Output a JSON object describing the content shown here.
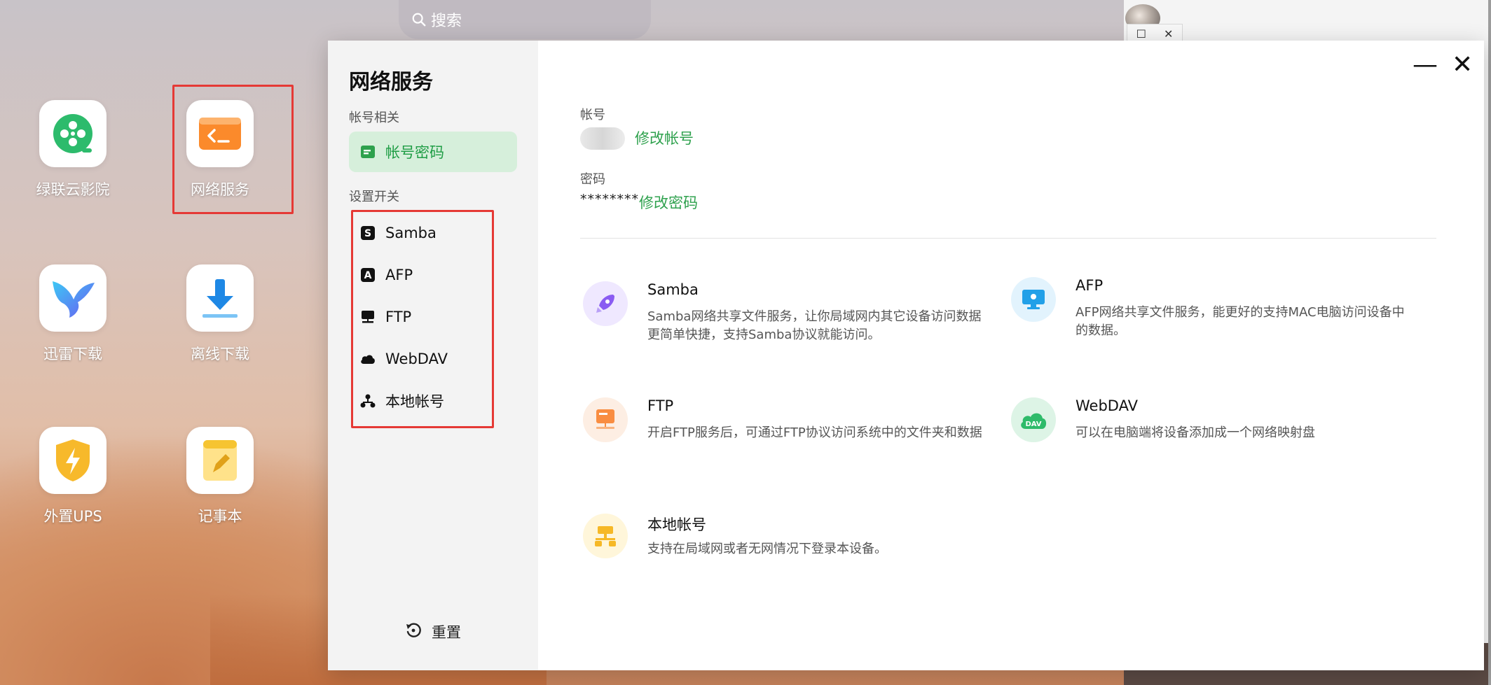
{
  "search": {
    "placeholder": "搜索"
  },
  "desktop": {
    "apps": [
      {
        "label": "绿联云影院",
        "icon": "film-reel-icon"
      },
      {
        "label": "网络服务",
        "icon": "terminal-icon"
      },
      {
        "label": "迅雷下载",
        "icon": "hummingbird-icon"
      },
      {
        "label": "离线下载",
        "icon": "download-arrow-icon"
      },
      {
        "label": "外置UPS",
        "icon": "shield-bolt-icon"
      },
      {
        "label": "记事本",
        "icon": "notepad-icon"
      }
    ]
  },
  "window": {
    "title": "网络服务",
    "sidebar": {
      "group_account": "帐号相关",
      "active_item": "帐号密码",
      "group_settings": "设置开关",
      "items": [
        "Samba",
        "AFP",
        "FTP",
        "WebDAV",
        "本地帐号"
      ],
      "reset_label": "重置"
    },
    "account": {
      "account_label": "帐号",
      "modify_account": "修改帐号",
      "password_label": "密码",
      "password_mask": "********",
      "modify_password": "修改密码"
    },
    "services": [
      {
        "name": "Samba",
        "desc": "Samba网络共享文件服务，让你局域网内其它设备访问数据更简单快捷，支持Samba协议就能访问。",
        "icon": "rocket-icon"
      },
      {
        "name": "AFP",
        "desc": "AFP网络共享文件服务，能更好的支持MAC电脑访问设备中的数据。",
        "icon": "mac-monitor-icon"
      },
      {
        "name": "FTP",
        "desc": "开启FTP服务后，可通过FTP协议访问系统中的文件夹和数据",
        "icon": "ftp-server-icon"
      },
      {
        "name": "WebDAV",
        "desc": "可以在电脑端将设备添加成一个网络映射盘",
        "icon": "dav-cloud-icon"
      },
      {
        "name": "本地帐号",
        "desc": "支持在局域网或者无网情况下登录本设备。",
        "icon": "local-account-icon"
      }
    ]
  },
  "colors": {
    "accent": "#2ea14d",
    "active_bg": "#d6efdb",
    "highlight_box": "#e53935"
  }
}
